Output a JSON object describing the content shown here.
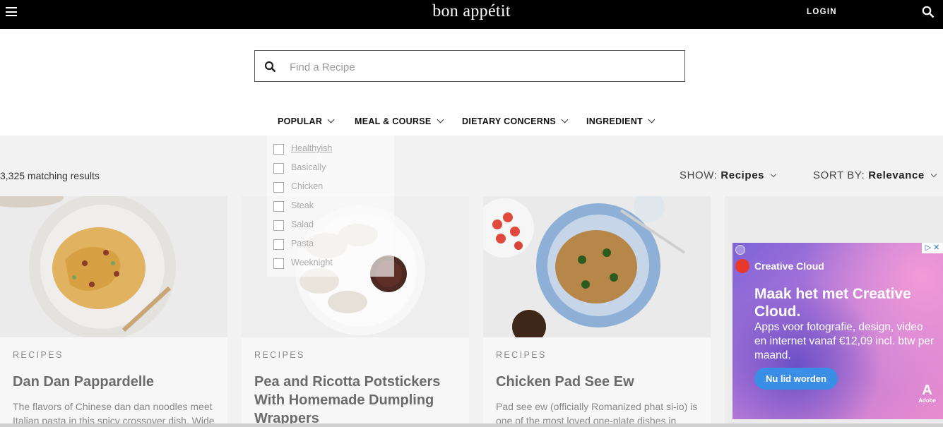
{
  "header": {
    "logo": "bon appétit",
    "login_label": "LOGIN",
    "menu_icon": "hamburger-icon",
    "search_icon": "search-icon"
  },
  "search": {
    "placeholder": "Find a Recipe",
    "value": "",
    "icon": "search-icon"
  },
  "filters": [
    {
      "label": "POPULAR"
    },
    {
      "label": "MEAL & COURSE"
    },
    {
      "label": "DIETARY CONCERNS"
    },
    {
      "label": "INGREDIENT"
    }
  ],
  "popular_dropdown": [
    {
      "label": "Healthyish",
      "checked": false
    },
    {
      "label": "Basically",
      "checked": false
    },
    {
      "label": "Chicken",
      "checked": false
    },
    {
      "label": "Steak",
      "checked": false
    },
    {
      "label": "Salad",
      "checked": false
    },
    {
      "label": "Pasta",
      "checked": false
    },
    {
      "label": "Weeknight",
      "checked": false
    }
  ],
  "results": {
    "count_text": "3,325 matching results",
    "show_label": "SHOW:",
    "show_value": "Recipes",
    "sort_label": "SORT BY:",
    "sort_value": "Relevance"
  },
  "cards": [
    {
      "kicker": "RECIPES",
      "title": "Dan Dan Pappardelle",
      "desc": "The flavors of Chinese dan dan noodles meet Italian pasta in this spicy crossover dish. Wide"
    },
    {
      "kicker": "RECIPES",
      "title": "Pea and Ricotta Potstickers With Homemade Dumpling Wrappers",
      "desc": ""
    },
    {
      "kicker": "RECIPES",
      "title": "Chicken Pad See Ew",
      "desc": "Pad see ew (officially Romanized phat si-io) is one of the most loved one-plate dishes in"
    }
  ],
  "ad": {
    "brand": "Creative Cloud",
    "headline": "Maak het met Creative Cloud.",
    "body": "Apps voor fotografie, design, video en internet vanaf €12,09 incl. btw per maand.",
    "cta": "Nu lid worden",
    "logo_text": "Adobe",
    "close": "▷ ✕"
  },
  "colors": {
    "header_bg": "#000000",
    "overlay_bg": "#f2f2f2",
    "ad_cta": "#3a8ee6"
  }
}
